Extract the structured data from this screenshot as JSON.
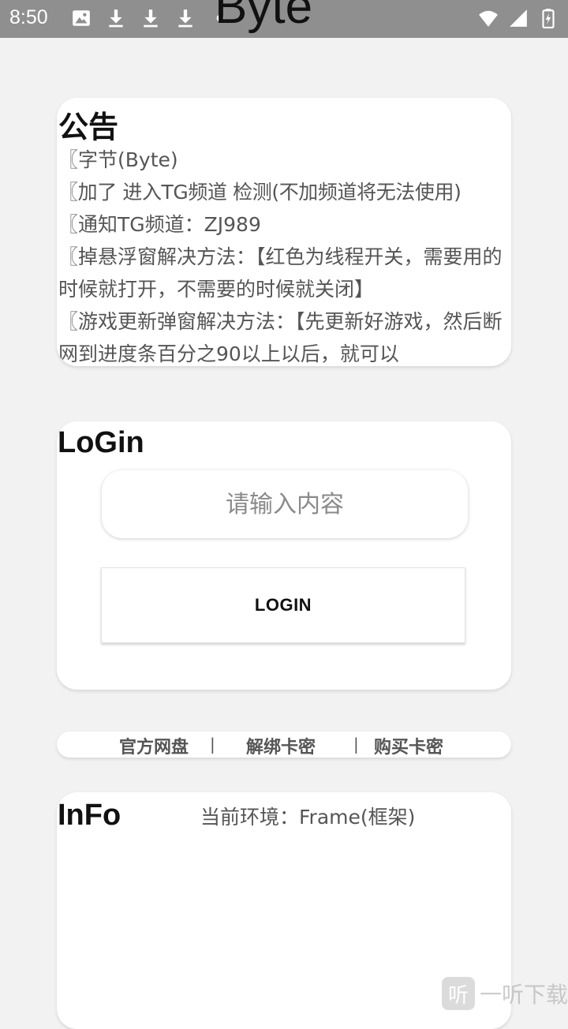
{
  "status_bar": {
    "time": "8:50",
    "left_icons": [
      "image-icon",
      "download-icon",
      "download-icon",
      "download-icon",
      "dot-icon"
    ],
    "right_icons": [
      "wifi-icon",
      "signal-icon",
      "battery-icon"
    ]
  },
  "background_title": "Byte",
  "notice": {
    "title": "公告",
    "lines": [
      "〖字节(Byte)",
      "〖加了 进入TG频道 检测(不加频道将无法使用)",
      "〖通知TG频道：ZJ989",
      "〖掉悬浮窗解决方法：【红色为线程开关，需要用的时候就打开，不需要的时候就关闭】",
      "〖游戏更新弹窗解决方法：【先更新好游戏，然后断网到进度条百分之90以上以后，就可以"
    ]
  },
  "login": {
    "title": "LoGin",
    "input_placeholder": "请输入内容",
    "button_label": "LOGIN"
  },
  "links": {
    "items": [
      "官方网盘",
      "解绑卡密",
      "购买卡密"
    ],
    "separator": "|"
  },
  "info": {
    "title": "InFo",
    "environment": "当前环境：Frame(框架)"
  },
  "watermark": {
    "logo_char": "听",
    "text": "一听下载"
  }
}
